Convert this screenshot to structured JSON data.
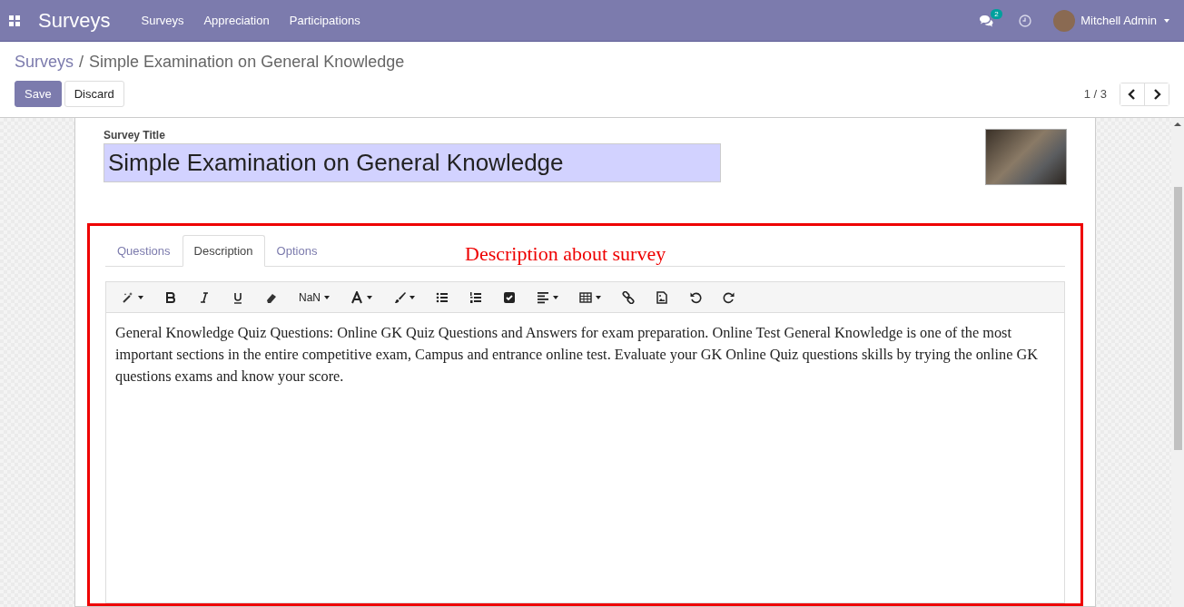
{
  "navbar": {
    "app_title": "Surveys",
    "menu": [
      "Surveys",
      "Appreciation",
      "Participations"
    ],
    "messages_badge": "2",
    "user_name": "Mitchell Admin"
  },
  "breadcrumb": {
    "parent": "Surveys",
    "separator": "/",
    "current": "Simple Examination on General Knowledge"
  },
  "buttons": [
    {
      "label": "Save",
      "kind": "primary"
    },
    {
      "label": "Discard",
      "kind": "secondary"
    }
  ],
  "pager": {
    "text": "1 / 3"
  },
  "form": {
    "title_label": "Survey Title",
    "title_value": "Simple Examination on General Knowledge",
    "tabs": [
      {
        "label": "Questions",
        "selected": false
      },
      {
        "label": "Description",
        "selected": true
      },
      {
        "label": "Options",
        "selected": false
      }
    ],
    "annotation": "Description about survey",
    "toolbar": [
      {
        "kind": "magic",
        "dropdown": true
      },
      {
        "kind": "bold",
        "dropdown": false
      },
      {
        "kind": "italic",
        "dropdown": false
      },
      {
        "kind": "underline",
        "dropdown": false
      },
      {
        "kind": "eraser",
        "dropdown": false
      },
      {
        "kind": "font-size",
        "label": "NaN",
        "dropdown": true
      },
      {
        "kind": "font-color",
        "dropdown": true
      },
      {
        "kind": "brush",
        "dropdown": true
      },
      {
        "kind": "bullets",
        "dropdown": false
      },
      {
        "kind": "numbers",
        "dropdown": false
      },
      {
        "kind": "checklist",
        "dropdown": false
      },
      {
        "kind": "align",
        "dropdown": true
      },
      {
        "kind": "table",
        "dropdown": true
      },
      {
        "kind": "link",
        "dropdown": false
      },
      {
        "kind": "image",
        "dropdown": false
      },
      {
        "kind": "undo",
        "dropdown": false
      },
      {
        "kind": "redo",
        "dropdown": false
      }
    ],
    "description": "General Knowledge Quiz Questions: Online GK Quiz Questions and Answers for exam preparation. Online Test General Knowledge is one of the most important sections in the entire competitive exam, Campus and entrance online test. Evaluate your GK Online Quiz questions skills by trying the online GK questions exams and know your score."
  }
}
